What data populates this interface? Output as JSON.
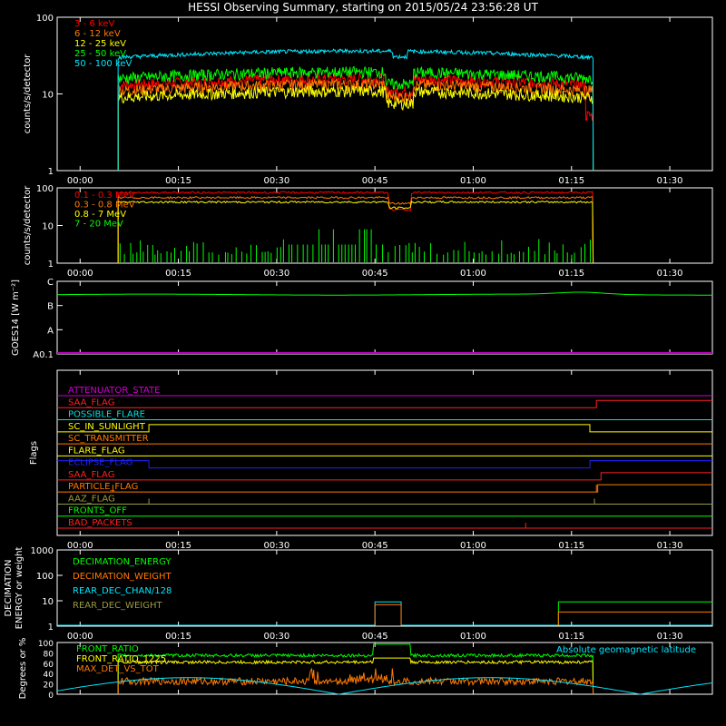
{
  "title": "HESSI Observing Summary, starting on 2015/05/24 23:56:28 UT",
  "time_ticks": [
    "00:00",
    "00:15",
    "00:30",
    "00:45",
    "01:00",
    "01:15",
    "01:30"
  ],
  "chart_data": [
    {
      "type": "line",
      "ylabel": "counts/s/detector",
      "y_scale": "log",
      "ylim": [
        1,
        100
      ],
      "ytick_labels": [
        "1",
        "10",
        "100"
      ],
      "x_units": "minutes after 2015/05/24 23:56:28 UT",
      "x_range": [
        0,
        100
      ],
      "series": [
        {
          "name": "3 - 6 keV",
          "color": "#ff0000",
          "shape": "main",
          "level": 13
        },
        {
          "name": "6 - 12 keV",
          "color": "#ff7a00",
          "shape": "main",
          "level": 11
        },
        {
          "name": "12 - 25 keV",
          "color": "#ffff00",
          "shape": "main",
          "level": 9
        },
        {
          "name": "25 - 50 keV",
          "color": "#00ff00",
          "shape": "main",
          "level": 16
        },
        {
          "name": "50 - 100 keV",
          "color": "#00e8ff",
          "shape": "main",
          "level": 30
        }
      ]
    },
    {
      "type": "line",
      "ylabel": "counts/s/detector",
      "y_scale": "log",
      "ylim": [
        1,
        100
      ],
      "ytick_labels": [
        "1",
        "10",
        "100"
      ],
      "series": [
        {
          "name": "0.1 - 0.3 MeV",
          "color": "#ff0000",
          "shape": "main",
          "level": 75
        },
        {
          "name": "0.3 - 0.8 MeV",
          "color": "#ff7a00",
          "shape": "main",
          "level": 55
        },
        {
          "name": "0.8 - 7 MeV",
          "color": "#ffff00",
          "shape": "main",
          "level": 42
        },
        {
          "name": "7 - 20 MeV",
          "color": "#00ff00",
          "shape": "spikes",
          "level": 1
        }
      ]
    },
    {
      "type": "line",
      "ylabel": "GOES14 [W m⁻²]",
      "ytick_labels": [
        "A0.1",
        "A",
        "B",
        "C"
      ],
      "series": [
        {
          "name": "GOES14",
          "color": "#00ff00",
          "shape": "goes",
          "level": 2.45
        }
      ]
    },
    {
      "type": "line",
      "ylabel": "Flags",
      "flags": [
        {
          "name": "ATTENUATOR_STATE",
          "color": "#d000d0"
        },
        {
          "name": "SAA_FLAG",
          "color": "#ff2020"
        },
        {
          "name": "POSSIBLE_FLARE",
          "color": "#00e0e0"
        },
        {
          "name": "SC_IN_SUNLIGHT",
          "color": "#ffff00"
        },
        {
          "name": "SC_TRANSMITTER",
          "color": "#ff7a00"
        },
        {
          "name": "FLARE_FLAG",
          "color": "#ffff00"
        },
        {
          "name": "ECLIPSE_FLAG",
          "color": "#2020ff"
        },
        {
          "name": "SAA_FLAG",
          "color": "#ff2020"
        },
        {
          "name": "PARTICLE_FLAG",
          "color": "#ff7a00"
        },
        {
          "name": "AAZ_FLAG",
          "color": "#9a9a40"
        },
        {
          "name": "FRONTS_OFF",
          "color": "#00ff00"
        },
        {
          "name": "BAD_PACKETS",
          "color": "#ff2020"
        }
      ]
    },
    {
      "type": "line",
      "ylabel": "DECIMATION ENERGY or weight",
      "y_scale": "log",
      "ylim": [
        1,
        1000
      ],
      "ytick_labels": [
        "1",
        "10",
        "100",
        "1000"
      ],
      "series": [
        {
          "name": "DECIMATION_ENERGY",
          "color": "#00ff00"
        },
        {
          "name": "DECIMATION_WEIGHT",
          "color": "#ff7a00"
        },
        {
          "name": "REAR_DEC_CHAN/128",
          "color": "#00e8ff"
        },
        {
          "name": "REAR_DEC_WEIGHT",
          "color": "#9a9a40"
        }
      ]
    },
    {
      "type": "line",
      "ylabel": "Degrees or %",
      "ylim": [
        0,
        100
      ],
      "ytick_labels": [
        "0",
        "20",
        "40",
        "60",
        "80",
        "100"
      ],
      "annotation": "Absolute geomagnetic latitude",
      "series": [
        {
          "name": "FRONT_RATIO",
          "color": "#00ff00",
          "level": 75
        },
        {
          "name": "FRONT_RATIO_1225",
          "color": "#ffff00",
          "level": 62
        },
        {
          "name": "MAX_DET_VS_TOT",
          "color": "#ff7a00",
          "level": 25
        }
      ]
    }
  ]
}
